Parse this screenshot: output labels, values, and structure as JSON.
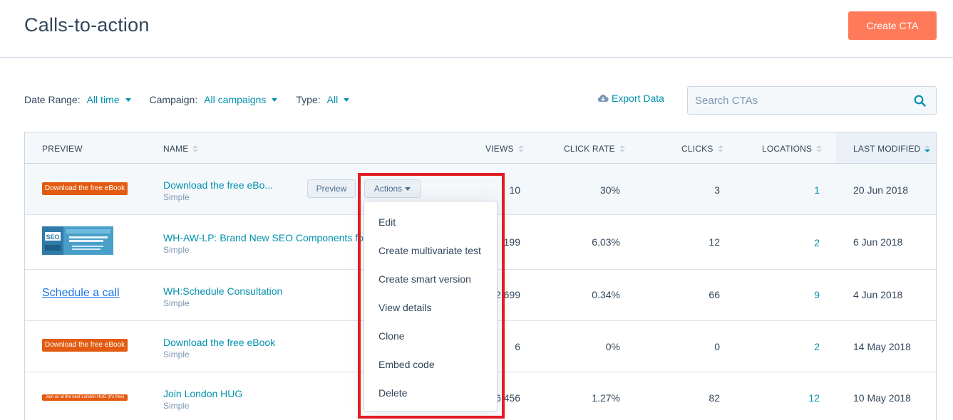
{
  "header": {
    "title": "Calls-to-action",
    "create_label": "Create CTA"
  },
  "filters": {
    "date_range": {
      "label": "Date Range:",
      "value": "All time"
    },
    "campaign": {
      "label": "Campaign:",
      "value": "All campaigns"
    },
    "type": {
      "label": "Type:",
      "value": "All"
    }
  },
  "export_label": "Export Data",
  "search": {
    "placeholder": "Search CTAs"
  },
  "columns": {
    "preview": "PREVIEW",
    "name": "NAME",
    "views": "VIEWS",
    "click_rate": "CLICK RATE",
    "clicks": "CLICKS",
    "locations": "LOCATIONS",
    "last_modified": "LAST MODIFIED"
  },
  "rows": [
    {
      "preview": "Download the free eBook",
      "name": "Download the free eBo...",
      "type": "Simple",
      "views": "10",
      "click_rate": "30%",
      "clicks": "3",
      "locations": "1",
      "last_modified": "20 Jun 2018"
    },
    {
      "preview": "",
      "name": "WH-AW-LP: Brand New SEO Components fo",
      "type": "Simple",
      "views": "199",
      "click_rate": "6.03%",
      "clicks": "12",
      "locations": "2",
      "last_modified": "6 Jun 2018"
    },
    {
      "preview": "Schedule a call",
      "name": "WH:Schedule Consultation",
      "type": "Simple",
      "views": "2,699",
      "click_rate": "0.34%",
      "clicks": "66",
      "locations": "9",
      "last_modified": "4 Jun 2018"
    },
    {
      "preview": "Download the free eBook",
      "name": "Download the free eBook",
      "type": "Simple",
      "views": "6",
      "click_rate": "0%",
      "clicks": "0",
      "locations": "2",
      "last_modified": "14 May 2018"
    },
    {
      "preview": "Join us at the next London HUG (it's free)",
      "name": "Join London HUG",
      "type": "Simple",
      "views": "6,456",
      "click_rate": "1.27%",
      "clicks": "82",
      "locations": "12",
      "last_modified": "10 May 2018"
    }
  ],
  "row_buttons": {
    "preview": "Preview",
    "actions": "Actions"
  },
  "actions_menu": [
    "Edit",
    "Create multivariate test",
    "Create smart version",
    "View details",
    "Clone",
    "Embed code",
    "Delete"
  ],
  "colors": {
    "accent": "#ff7a59",
    "link": "#0091ae",
    "highlight": "#e31b23",
    "cta_orange": "#e35b10"
  },
  "icons": {
    "export": "cloud-download-icon",
    "search": "search-icon",
    "sort": "sort-icon"
  }
}
